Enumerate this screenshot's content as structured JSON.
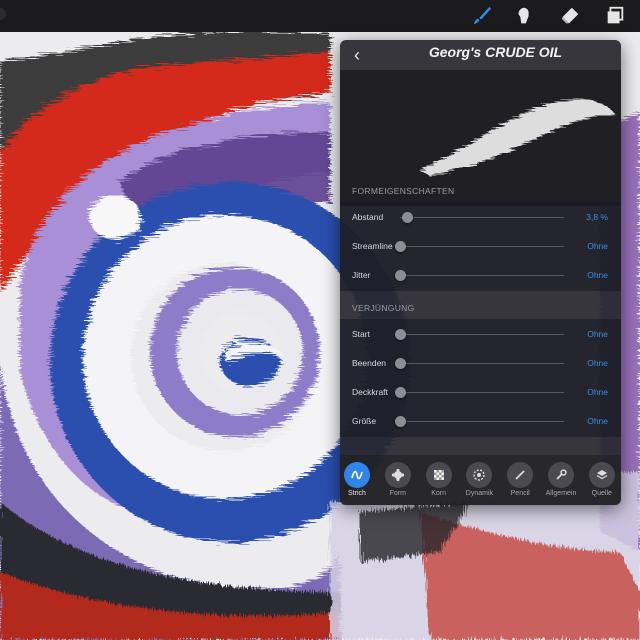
{
  "toolbar": {
    "tools": [
      {
        "name": "brush",
        "active": true
      },
      {
        "name": "smudge",
        "active": false
      },
      {
        "name": "eraser",
        "active": false
      },
      {
        "name": "layers",
        "active": false
      }
    ]
  },
  "panel": {
    "back_icon": "chevron-left",
    "title": "Georg's CRUDE OIL",
    "shape_section": {
      "header": "FORMEIGENSCHAFTEN",
      "rows": [
        {
          "label": "Abstand",
          "value": "3,8 %",
          "level": 0.04
        },
        {
          "label": "Streamline",
          "value": "Ohne",
          "level": 0
        },
        {
          "label": "Jitter",
          "value": "Ohne",
          "level": 0
        }
      ]
    },
    "taper_section": {
      "header": "VERJÜNGUNG",
      "rows": [
        {
          "label": "Start",
          "value": "Ohne",
          "level": 0
        },
        {
          "label": "Beenden",
          "value": "Ohne",
          "level": 0
        },
        {
          "label": "Deckkraft",
          "value": "Ohne",
          "level": 0
        },
        {
          "label": "Größe",
          "value": "Ohne",
          "level": 0
        }
      ]
    },
    "tabs": [
      {
        "label": "Strich",
        "icon": "stroke-icon",
        "active": true
      },
      {
        "label": "Form",
        "icon": "shape-icon",
        "active": false
      },
      {
        "label": "Korn",
        "icon": "grain-icon",
        "active": false
      },
      {
        "label": "Dynamik",
        "icon": "dynamics-icon",
        "active": false
      },
      {
        "label": "Pencil",
        "icon": "pencil-icon",
        "active": false
      },
      {
        "label": "Allgemein",
        "icon": "wrench-icon",
        "active": false
      },
      {
        "label": "Quelle",
        "icon": "layers-icon",
        "active": false
      }
    ]
  },
  "colors": {
    "accent": "#2f86e8",
    "value_blue": "#3b8be0",
    "panel_bg": "#28282e",
    "paint_red": "#d42a1c",
    "paint_purple": "#a98fd6",
    "paint_blue": "#2a4fae",
    "paint_white": "#f4f4f6"
  }
}
